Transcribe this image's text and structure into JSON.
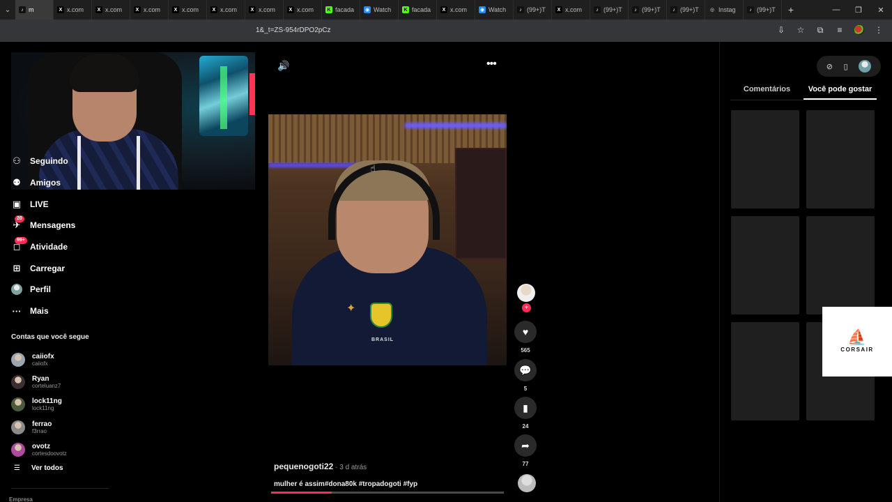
{
  "browser": {
    "tabs": [
      {
        "label": "m",
        "favicon": "tiktok",
        "active": true
      },
      {
        "label": "x.com",
        "favicon": "x"
      },
      {
        "label": "x.com",
        "favicon": "x"
      },
      {
        "label": "x.com",
        "favicon": "x"
      },
      {
        "label": "x.com",
        "favicon": "x"
      },
      {
        "label": "x.com",
        "favicon": "x"
      },
      {
        "label": "x.com",
        "favicon": "x"
      },
      {
        "label": "x.com",
        "favicon": "x"
      },
      {
        "label": "facada",
        "favicon": "kick"
      },
      {
        "label": "Watch",
        "favicon": "watch"
      },
      {
        "label": "facada",
        "favicon": "kick"
      },
      {
        "label": "x.com",
        "favicon": "x"
      },
      {
        "label": "Watch",
        "favicon": "watch"
      },
      {
        "label": "(99+)T",
        "favicon": "tiktok"
      },
      {
        "label": "x.com",
        "favicon": "x"
      },
      {
        "label": "(99+)T",
        "favicon": "tiktok"
      },
      {
        "label": "(99+)T",
        "favicon": "tiktok"
      },
      {
        "label": "(99+)T",
        "favicon": "tiktok"
      },
      {
        "label": "Instag",
        "favicon": "instagram"
      },
      {
        "label": "(99+)T",
        "favicon": "tiktok"
      }
    ],
    "new_tab": "+",
    "url": "1&_t=ZS-954rDPO2pCz"
  },
  "sidebar": {
    "nav": [
      {
        "label": "Seguindo",
        "icon": "following-icon",
        "badge": ""
      },
      {
        "label": "Amigos",
        "icon": "friends-icon",
        "badge": ""
      },
      {
        "label": "LIVE",
        "icon": "live-icon",
        "badge": ""
      },
      {
        "label": "Mensagens",
        "icon": "messages-icon",
        "badge": "20"
      },
      {
        "label": "Atividade",
        "icon": "activity-icon",
        "badge": "99+"
      },
      {
        "label": "Carregar",
        "icon": "upload-icon",
        "badge": ""
      },
      {
        "label": "Perfil",
        "icon": "profile-avatar",
        "badge": ""
      },
      {
        "label": "Mais",
        "icon": "more-icon",
        "badge": ""
      }
    ],
    "following_title": "Contas que você segue",
    "accounts": [
      {
        "name": "caiiofx",
        "handle": "caiiofx",
        "color": "#9aa6b2"
      },
      {
        "name": "Ryan",
        "handle": "corteluanz7",
        "color": "#3a3030"
      },
      {
        "name": "lock11ng",
        "handle": "lock11ng",
        "color": "#4a5a3a"
      },
      {
        "name": "ferrao",
        "handle": "f3rrao",
        "color": "#8a8a88"
      },
      {
        "name": "ovotz",
        "handle": "cortesdoovotz",
        "color": "#b04aa0"
      }
    ],
    "see_all": "Ver todos",
    "company": "Empresa"
  },
  "video": {
    "creator": "pequenogoti22",
    "time": " · 3 d atrás",
    "caption": "mulher é assim#dona80k #tropadogoti #fyp",
    "progress": 0.26,
    "shirt_text": "BRASIL",
    "actions": {
      "likes": "565",
      "comments": "5",
      "saves": "24",
      "shares": "77"
    }
  },
  "right_panel": {
    "tabs": [
      {
        "label": "Comentários",
        "active": false
      },
      {
        "label": "Você pode gostar",
        "active": true
      }
    ]
  },
  "ad": {
    "brand": "CORSAIR"
  },
  "colors": {
    "accent": "#fe2c55",
    "background": "#000000"
  }
}
